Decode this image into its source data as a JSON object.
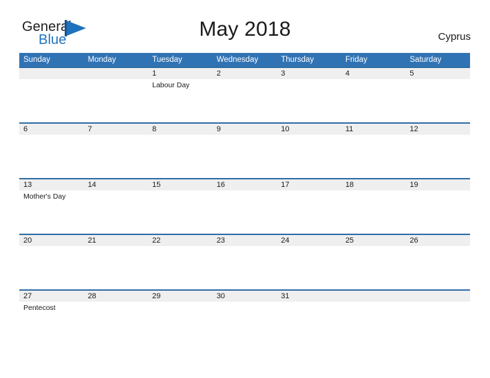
{
  "brand": {
    "name_part1": "General",
    "name_part2": "Blue",
    "mark_icon": "triangle-flag-icon",
    "accent_color": "#1f72bd"
  },
  "header": {
    "title": "May 2018",
    "region": "Cyprus"
  },
  "theme": {
    "header_blue": "#3073b4",
    "rule_blue": "#2e6da4",
    "band_gray": "#efefef",
    "text_color": "#1a1a1a"
  },
  "weekdays": [
    "Sunday",
    "Monday",
    "Tuesday",
    "Wednesday",
    "Thursday",
    "Friday",
    "Saturday"
  ],
  "weeks": [
    {
      "days": [
        {
          "number": "",
          "event": ""
        },
        {
          "number": "",
          "event": ""
        },
        {
          "number": "1",
          "event": "Labour Day"
        },
        {
          "number": "2",
          "event": ""
        },
        {
          "number": "3",
          "event": ""
        },
        {
          "number": "4",
          "event": ""
        },
        {
          "number": "5",
          "event": ""
        }
      ]
    },
    {
      "days": [
        {
          "number": "6",
          "event": ""
        },
        {
          "number": "7",
          "event": ""
        },
        {
          "number": "8",
          "event": ""
        },
        {
          "number": "9",
          "event": ""
        },
        {
          "number": "10",
          "event": ""
        },
        {
          "number": "11",
          "event": ""
        },
        {
          "number": "12",
          "event": ""
        }
      ]
    },
    {
      "days": [
        {
          "number": "13",
          "event": "Mother's Day"
        },
        {
          "number": "14",
          "event": ""
        },
        {
          "number": "15",
          "event": ""
        },
        {
          "number": "16",
          "event": ""
        },
        {
          "number": "17",
          "event": ""
        },
        {
          "number": "18",
          "event": ""
        },
        {
          "number": "19",
          "event": ""
        }
      ]
    },
    {
      "days": [
        {
          "number": "20",
          "event": ""
        },
        {
          "number": "21",
          "event": ""
        },
        {
          "number": "22",
          "event": ""
        },
        {
          "number": "23",
          "event": ""
        },
        {
          "number": "24",
          "event": ""
        },
        {
          "number": "25",
          "event": ""
        },
        {
          "number": "26",
          "event": ""
        }
      ]
    },
    {
      "days": [
        {
          "number": "27",
          "event": "Pentecost"
        },
        {
          "number": "28",
          "event": ""
        },
        {
          "number": "29",
          "event": ""
        },
        {
          "number": "30",
          "event": ""
        },
        {
          "number": "31",
          "event": ""
        },
        {
          "number": "",
          "event": ""
        },
        {
          "number": "",
          "event": ""
        }
      ]
    }
  ]
}
